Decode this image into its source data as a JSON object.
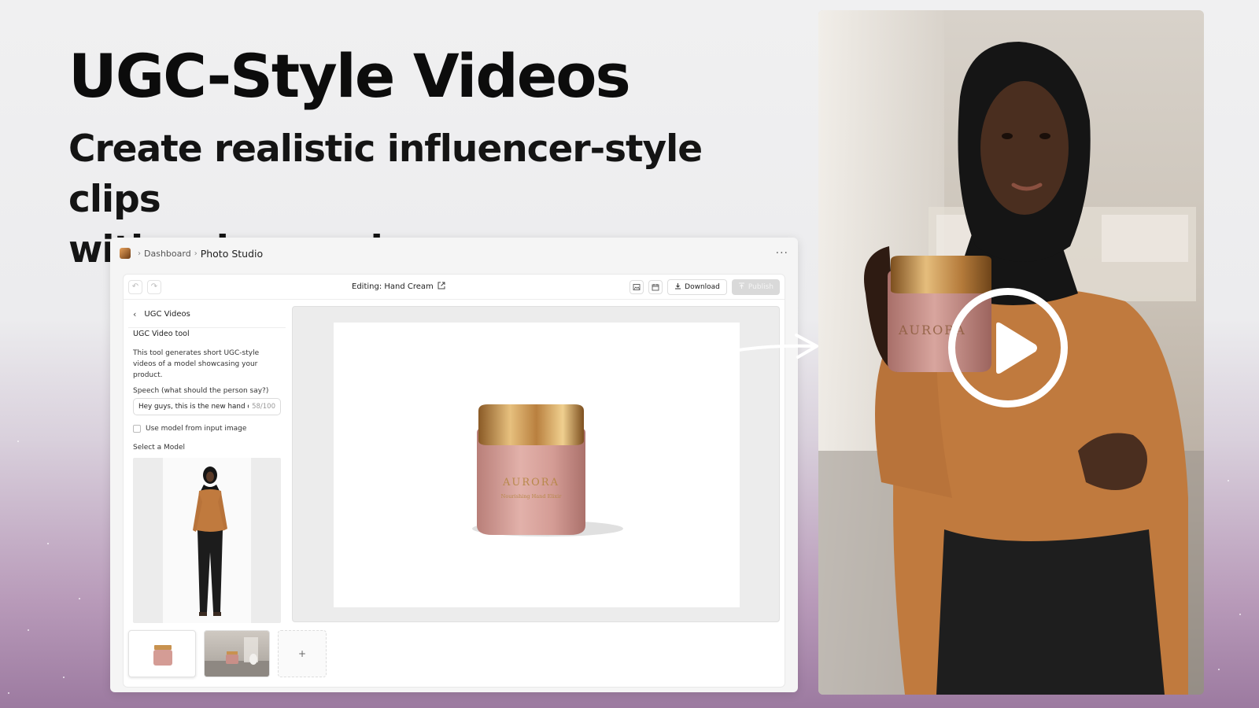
{
  "hero": {
    "title": "UGC-Style Videos",
    "subtitle_line1": "Create realistic influencer-style clips",
    "subtitle_line2": "with voices and scenes."
  },
  "app": {
    "breadcrumb": {
      "root": "Dashboard",
      "current": "Photo Studio"
    },
    "more_label": "···",
    "toolbar": {
      "undo_icon": "↶",
      "redo_icon": "↷",
      "editing_label": "Editing: Hand Cream",
      "download_label": "Download",
      "publish_label": "Publish"
    },
    "sidebar": {
      "back_label": "UGC Videos",
      "panel_title": "UGC Video tool",
      "description": "This tool generates short UGC-style videos of a model showcasing your product.",
      "speech_label": "Speech (what should the person say?)",
      "speech_value": "Hey guys, this is the new hand c",
      "speech_count": "58/100",
      "checkbox_label": "Use model from input image",
      "select_model_label": "Select a Model"
    },
    "product": {
      "brand": "AURORA",
      "line": "Nourishing Hand Elixir"
    },
    "thumbnails": {
      "add_label": "+"
    }
  },
  "colors": {
    "jar_pink": "#d49c95",
    "lid_gold": "#c8924f",
    "shirt_orange": "#c07a3e",
    "hijab": "#151515"
  }
}
